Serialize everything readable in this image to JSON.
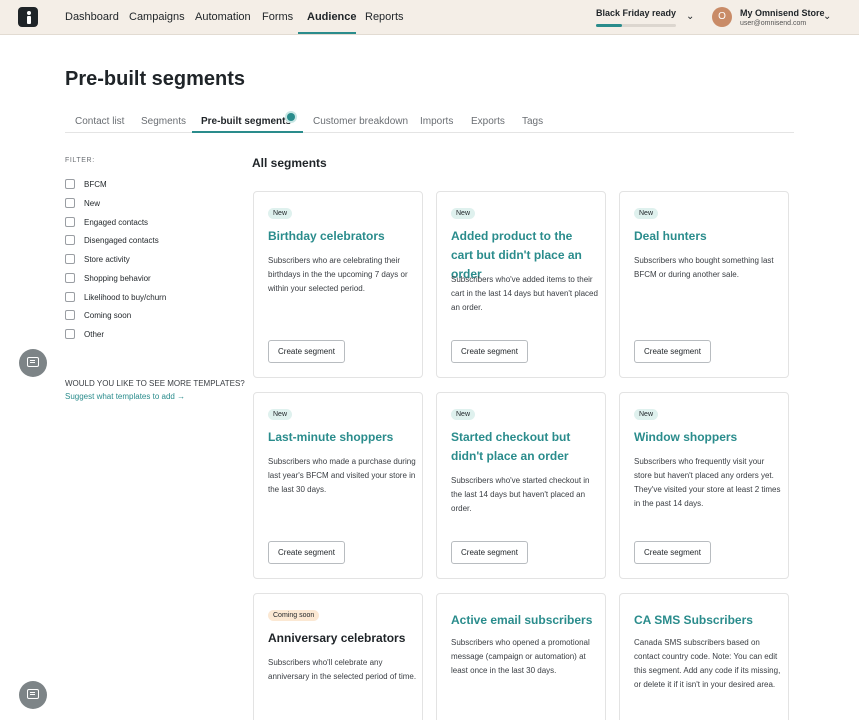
{
  "nav": {
    "items": [
      "Dashboard",
      "Campaigns",
      "Automation",
      "Forms",
      "Audience",
      "Reports"
    ],
    "active": "Audience"
  },
  "progress": {
    "label": "Black Friday ready",
    "value_fraction": 0.33,
    "accent": "#2a8c8c"
  },
  "account": {
    "initial": "O",
    "store_name": "My Omnisend Store",
    "email": "user@omnisend.com",
    "avatar_color": "#c98b67"
  },
  "page": {
    "title": "Pre-built segments"
  },
  "tabs": [
    "Contact list",
    "Segments",
    "Pre-built segments",
    "Customer breakdown",
    "Imports",
    "Exports",
    "Tags"
  ],
  "filter": {
    "title": "FILTER:",
    "items": [
      "BFCM",
      "New",
      "Engaged contacts",
      "Disengaged contacts",
      "Store activity",
      "Shopping behavior",
      "Likelihood to buy/churn",
      "Coming soon",
      "Other"
    ],
    "more_question": "WOULD YOU LIKE TO SEE MORE TEMPLATES?",
    "more_link": "Suggest what templates to add →"
  },
  "main": {
    "title": "All segments"
  },
  "cards": [
    {
      "badge": "New",
      "title": "Birthday celebrators",
      "desc": "Subscribers who are celebrating their birthdays in the the upcoming 7 days or within your selected period.",
      "button": "Create segment"
    },
    {
      "badge": "New",
      "title": "Added product to the cart but didn't place an order",
      "desc": "Subscribers who've added items to their cart in the last 14 days but haven't placed an order.",
      "button": "Create segment"
    },
    {
      "badge": "New",
      "title": "Deal hunters",
      "desc": "Subscribers who bought something last BFCM or during another sale.",
      "button": "Create segment"
    },
    {
      "badge": "New",
      "title": "Last-minute shoppers",
      "desc": "Subscribers who made a purchase during last year's BFCM and visited your store in the last 30 days.",
      "button": "Create segment"
    },
    {
      "badge": "New",
      "title": "Started checkout but didn't place an order",
      "desc": "Subscribers who've started checkout in the last 14 days but haven't placed an order.",
      "button": "Create segment"
    },
    {
      "badge": "New",
      "title": "Window shoppers",
      "desc": "Subscribers who frequently visit your store but haven't placed any orders yet. They've visited your store at least 2 times in the past 14 days.",
      "button": "Create segment"
    },
    {
      "badge": "Coming soon",
      "title": "Anniversary celebrators",
      "desc": "Subscribers who'll celebrate any anniversary in the selected period of time."
    },
    {
      "title": "Active email subscribers",
      "desc": "Subscribers who opened a promotional message (campaign or automation) at least once in the last 30 days."
    },
    {
      "title": "CA SMS Subscribers",
      "desc": "Canada SMS subscribers based on contact country code. Note: You can edit this segment. Add any code if its missing, or delete it if it isn't in your desired area."
    }
  ],
  "icons": {
    "logo": "omnisend-logo",
    "chat": "chat-icon",
    "chevron": "chevron-down-icon"
  }
}
